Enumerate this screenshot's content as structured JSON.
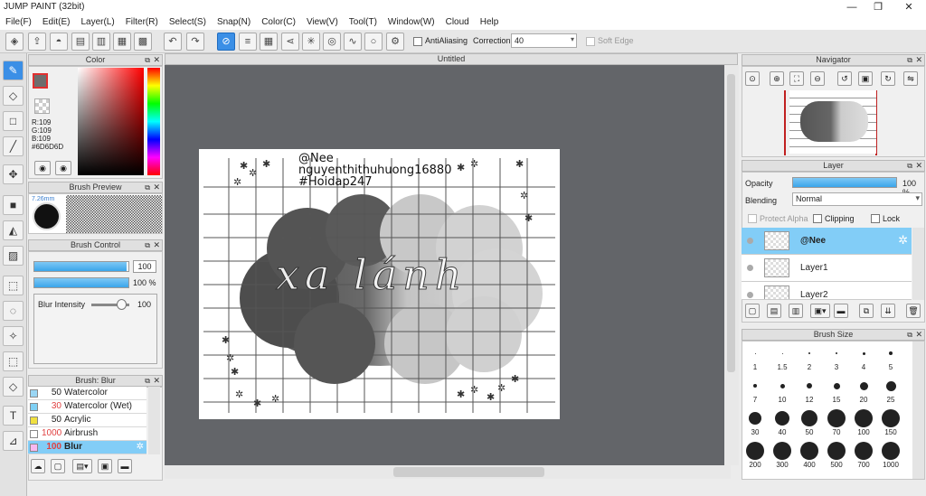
{
  "app": {
    "title": "JUMP PAINT (32bit)",
    "win_controls": [
      "—",
      "❐",
      "✕"
    ]
  },
  "menu": [
    "File(F)",
    "Edit(E)",
    "Layer(L)",
    "Filter(R)",
    "Select(S)",
    "Snap(N)",
    "Color(C)",
    "View(V)",
    "Tool(T)",
    "Window(W)",
    "Cloud",
    "Help"
  ],
  "toolbar": {
    "antialiasing_label": "AntiAliasing",
    "correction_label": "Correction",
    "correction_value": "40",
    "soft_edge_label": "Soft Edge"
  },
  "color_panel": {
    "title": "Color",
    "r": "R:109",
    "g": "G:109",
    "b": "B:109",
    "hex": "#6D6D6D",
    "fg": "#6d6d6d"
  },
  "brush_preview": {
    "title": "Brush Preview",
    "size": "7.26mm"
  },
  "brush_control": {
    "title": "Brush Control",
    "size_value": "100",
    "opacity_value": "100 %",
    "opacity_fill": 1.0,
    "size_fill": 0.98,
    "blur_label": "Blur Intensity",
    "blur_value": "100",
    "blur_level": 0.8
  },
  "brush_list": {
    "title": "Brush: Blur",
    "items": [
      {
        "num": "50",
        "name": "Watercolor",
        "color": "#9ad6f4",
        "num_color": "#222"
      },
      {
        "num": "30",
        "name": "Watercolor (Wet)",
        "color": "#7fd0f4",
        "num_color": "#e04040"
      },
      {
        "num": "50",
        "name": "Acrylic",
        "color": "#f0e040",
        "num_color": "#222"
      },
      {
        "num": "1000",
        "name": "Airbrush",
        "color": "#ffffff",
        "num_color": "#e04040"
      },
      {
        "num": "100",
        "name": "Blur",
        "color": "#f7b8f0",
        "num_color": "#e04040"
      }
    ]
  },
  "canvas": {
    "tab_title": "Untitled",
    "watermark_1": "@Nee",
    "watermark_2": "nguyenthithuhuong16880",
    "watermark_3": "#Hoidap247",
    "art_text": "xa lánh"
  },
  "navigator": {
    "title": "Navigator"
  },
  "layer_panel": {
    "title": "Layer",
    "opacity_label": "Opacity",
    "opacity_value": "100 %",
    "blending_label": "Blending",
    "blending_value": "Normal",
    "protect_alpha": "Protect Alpha",
    "clipping": "Clipping",
    "lock": "Lock",
    "layers": [
      {
        "name": "@Nee"
      },
      {
        "name": "Layer1"
      },
      {
        "name": "Layer2"
      }
    ]
  },
  "brush_size": {
    "title": "Brush Size",
    "sizes": [
      "1",
      "1.5",
      "2",
      "3",
      "4",
      "5",
      "7",
      "10",
      "12",
      "15",
      "20",
      "25",
      "30",
      "40",
      "50",
      "70",
      "100",
      "150",
      "200",
      "300",
      "400",
      "500",
      "700",
      "1000"
    ]
  }
}
